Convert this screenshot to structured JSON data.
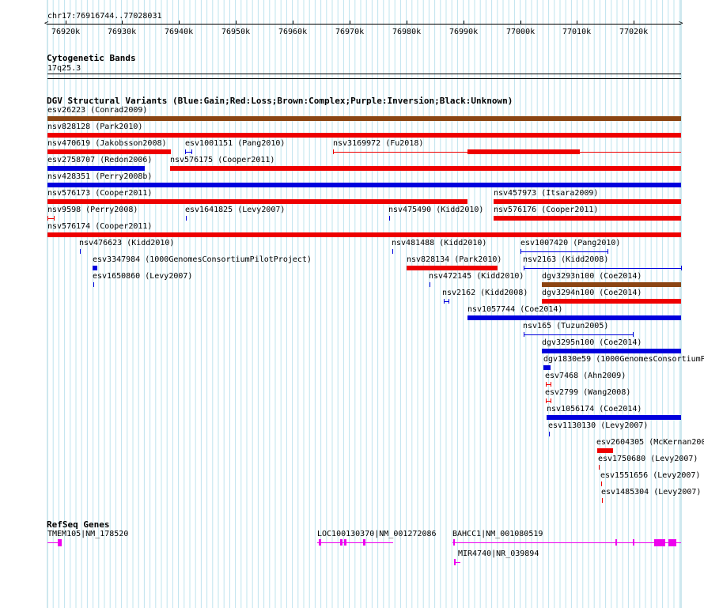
{
  "ruler": {
    "range_label": "chr17:76916744..77028031",
    "ticks": [
      "76920k",
      "76930k",
      "76940k",
      "76950k",
      "76960k",
      "76970k",
      "76980k",
      "76990k",
      "77000k",
      "77010k",
      "77020k"
    ]
  },
  "cyto": {
    "title": "Cytogenetic Bands",
    "band": "17q25.3"
  },
  "dgv": {
    "title": "DGV Structural Variants (Blue:Gain;Red:Loss;Brown:Complex;Purple:Inversion;Black:Unknown)",
    "colors": {
      "gain": "#0000dd",
      "loss": "#ee0000",
      "complex": "#8b4513"
    },
    "features": [
      {
        "label": "esv26223 (Conrad2009)",
        "type": "complex"
      },
      {
        "label": "nsv828128 (Park2010)",
        "type": "loss"
      },
      {
        "label": "nsv470619 (Jakobsson2008)",
        "type": "loss"
      },
      {
        "label": "esv1001151 (Pang2010)",
        "type": "gain"
      },
      {
        "label": "nsv3169972 (Fu2018)",
        "type": "loss"
      },
      {
        "label": "esv2758707 (Redon2006)",
        "type": "gain"
      },
      {
        "label": "nsv576175 (Cooper2011)",
        "type": "loss"
      },
      {
        "label": "nsv428351 (Perry2008b)",
        "type": "gain"
      },
      {
        "label": "nsv576173 (Cooper2011)",
        "type": "loss"
      },
      {
        "label": "nsv457973 (Itsara2009)",
        "type": "loss"
      },
      {
        "label": "nsv9598 (Perry2008)",
        "type": "loss"
      },
      {
        "label": "esv1641825 (Levy2007)",
        "type": "gain"
      },
      {
        "label": "nsv475490 (Kidd2010)",
        "type": "gain"
      },
      {
        "label": "nsv576176 (Cooper2011)",
        "type": "loss"
      },
      {
        "label": "nsv576174 (Cooper2011)",
        "type": "loss"
      },
      {
        "label": "nsv476623 (Kidd2010)",
        "type": "gain"
      },
      {
        "label": "nsv481488 (Kidd2010)",
        "type": "gain"
      },
      {
        "label": "esv1007420 (Pang2010)",
        "type": "gain"
      },
      {
        "label": "esv3347984 (1000GenomesConsortiumPilotProject)",
        "type": "gain"
      },
      {
        "label": "nsv828134 (Park2010)",
        "type": "loss"
      },
      {
        "label": "nsv2163 (Kidd2008)",
        "type": "gain"
      },
      {
        "label": "esv1650860 (Levy2007)",
        "type": "gain"
      },
      {
        "label": "nsv472145 (Kidd2010)",
        "type": "gain"
      },
      {
        "label": "dgv3293n100 (Coe2014)",
        "type": "complex"
      },
      {
        "label": "nsv2162 (Kidd2008)",
        "type": "gain"
      },
      {
        "label": "dgv3294n100 (Coe2014)",
        "type": "loss"
      },
      {
        "label": "nsv1057744 (Coe2014)",
        "type": "gain"
      },
      {
        "label": "nsv165 (Tuzun2005)",
        "type": "gain"
      },
      {
        "label": "dgv3295n100 (Coe2014)",
        "type": "gain"
      },
      {
        "label": "dgv1830e59 (1000GenomesConsortiumP",
        "type": "gain"
      },
      {
        "label": "esv7468 (Ahn2009)",
        "type": "loss"
      },
      {
        "label": "esv2799 (Wang2008)",
        "type": "loss"
      },
      {
        "label": "nsv1056174 (Coe2014)",
        "type": "gain"
      },
      {
        "label": "esv1130130 (Levy2007)",
        "type": "gain"
      },
      {
        "label": "esv2604305 (McKernan200",
        "type": "loss"
      },
      {
        "label": "esv1750680 (Levy2007)",
        "type": "loss"
      },
      {
        "label": "esv1551656 (Levy2007)",
        "type": "loss"
      },
      {
        "label": "esv1485304 (Levy2007)",
        "type": "loss"
      }
    ]
  },
  "refseq": {
    "title": "RefSeq Genes",
    "color": "#ee00ee",
    "genes": [
      {
        "label": "TMEM105|NM_178520"
      },
      {
        "label": "LOC100130370|NM_001272086"
      },
      {
        "label": "BAHCC1|NM_001080519"
      },
      {
        "label": "MIR4740|NR_039894"
      }
    ]
  }
}
